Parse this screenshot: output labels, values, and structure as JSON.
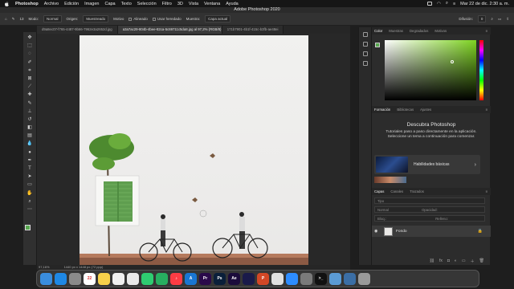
{
  "menubar": {
    "app_name": "Photoshop",
    "items": [
      "Archivo",
      "Edición",
      "Imagen",
      "Capa",
      "Texto",
      "Selección",
      "Filtro",
      "3D",
      "Vista",
      "Ventana",
      "Ayuda"
    ],
    "clock": "Mar 22 de dic.  2:30 a. m."
  },
  "window": {
    "title": "Adobe Photoshop 2020"
  },
  "options": {
    "size": "13",
    "mode_label": "Modo:",
    "mode_value": "Normal",
    "origin_label": "Origen:",
    "origin_sampled": "Muestreado",
    "origin_pattern": "Motivo",
    "aligned_label": "Alineado",
    "sample_legacy_label": "Usar heredado",
    "sample_label": "Muestra:",
    "sample_value": "Capa actual",
    "spread_label": "Difusión:",
    "spread_value": "0"
  },
  "tabs": [
    {
      "label": "d9a8ec07-f765-4487-9b66-7962e3a2652d.jpg",
      "active": false
    },
    {
      "label": "a3a7ac29-804b-4bee-82ca-5c69711c5da8.jpg al 97,2% (RGB/8) *",
      "active": true
    },
    {
      "label": "171b7901-4b1f-415c-b3fb-ae48ei",
      "active": false
    }
  ],
  "status": {
    "zoom": "97,16%",
    "dimensions": "1440 px x 1448 px (72 ppp)"
  },
  "panels": {
    "color_tabs": [
      "Color",
      "Muestras",
      "Degradados",
      "Motivos"
    ],
    "learn_tabs": [
      "Formación",
      "Bibliotecas",
      "Ajustes"
    ],
    "learn_title": "Descubra Photoshop",
    "learn_desc": "Tutoriales paso a paso directamente en la aplicación. Seleccione un tema a continuación para comenzar.",
    "learn_card_label": "Habilidades básicas",
    "layers_tabs": [
      "Capas",
      "Canales",
      "Trazados"
    ],
    "layers_kind": "Tipo",
    "layers_blend": "Normal",
    "layers_opacity_label": "Opacidad:",
    "layers_lock_label": "Bloq.:",
    "layers_fill_label": "Relleno:",
    "layer_name": "Fondo"
  },
  "colors": {
    "foreground": "#57a84f",
    "background": "#ffffff",
    "accent": "#7ed321"
  },
  "dock_apps": [
    {
      "name": "Finder",
      "color": "#3a8dde",
      "glyph": ""
    },
    {
      "name": "Safari",
      "color": "#1e88e5",
      "glyph": ""
    },
    {
      "name": "Launchpad",
      "color": "#8a8a8a",
      "glyph": ""
    },
    {
      "name": "Calendario",
      "color": "#ffffff",
      "glyph": "22"
    },
    {
      "name": "Notas",
      "color": "#f7d14a",
      "glyph": ""
    },
    {
      "name": "Recordatorios",
      "color": "#f0f0f0",
      "glyph": ""
    },
    {
      "name": "Fotos",
      "color": "#e9e9e9",
      "glyph": ""
    },
    {
      "name": "Mensajes",
      "color": "#2ecc71",
      "glyph": ""
    },
    {
      "name": "FaceTime",
      "color": "#27ae60",
      "glyph": ""
    },
    {
      "name": "Música",
      "color": "#fc3c44",
      "glyph": "♪"
    },
    {
      "name": "App Store",
      "color": "#1976d2",
      "glyph": "A"
    },
    {
      "name": "Premiere Pro",
      "color": "#2a0a4a",
      "glyph": "Pr"
    },
    {
      "name": "Photoshop",
      "color": "#0a1f3a",
      "glyph": "Ps"
    },
    {
      "name": "After Effects",
      "color": "#1b0b3b",
      "glyph": "Ae"
    },
    {
      "name": "Media Encoder",
      "color": "#1a1a4a",
      "glyph": ""
    },
    {
      "name": "PowerPoint",
      "color": "#d24726",
      "glyph": "P"
    },
    {
      "name": "Chrome",
      "color": "#e0e0e0",
      "glyph": ""
    },
    {
      "name": "Zoom",
      "color": "#2d8cff",
      "glyph": ""
    },
    {
      "name": "Preferencias",
      "color": "#7a7a7a",
      "glyph": ""
    },
    {
      "name": "Terminal",
      "color": "#111111",
      "glyph": ">_"
    },
    {
      "name": "Vista previa",
      "color": "#5b9bd5",
      "glyph": ""
    },
    {
      "name": "Pantalla",
      "color": "#3b6ea5",
      "glyph": ""
    },
    {
      "name": "Papelera",
      "color": "#9a9a9a",
      "glyph": ""
    }
  ]
}
